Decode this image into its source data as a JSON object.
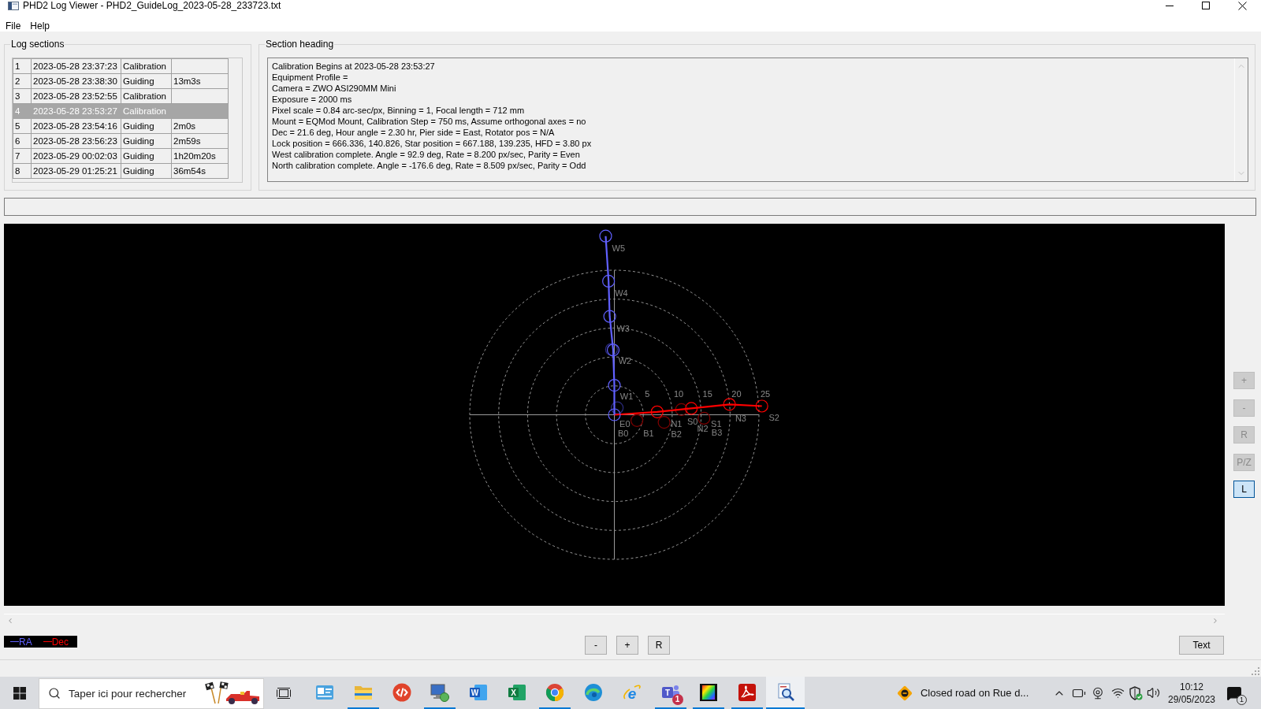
{
  "window": {
    "title": "PHD2 Log Viewer - PHD2_GuideLog_2023-05-28_233723.txt"
  },
  "menu": [
    "File",
    "Help"
  ],
  "log_sections": {
    "title": "Log sections",
    "rows": [
      {
        "cells": [
          "1",
          "2023-05-28 23:37:23",
          "Calibration"
        ],
        "selected": false
      },
      {
        "cells": [
          "2",
          "2023-05-28 23:38:30",
          "Guiding",
          "13m3s"
        ],
        "selected": false
      },
      {
        "cells": [
          "3",
          "2023-05-28 23:52:55",
          "Calibration"
        ],
        "selected": false
      },
      {
        "cells": [
          "4",
          "2023-05-28 23:53:27",
          "Calibration"
        ],
        "selected": true
      },
      {
        "cells": [
          "5",
          "2023-05-28 23:54:16",
          "Guiding",
          "2m0s"
        ],
        "selected": false
      },
      {
        "cells": [
          "6",
          "2023-05-28 23:56:23",
          "Guiding",
          "2m59s"
        ],
        "selected": false
      },
      {
        "cells": [
          "7",
          "2023-05-29 00:02:03",
          "Guiding",
          "1h20m20s"
        ],
        "selected": false
      },
      {
        "cells": [
          "8",
          "2023-05-29 01:25:21",
          "Guiding",
          "36m54s"
        ],
        "selected": false
      }
    ]
  },
  "section_heading": {
    "title": "Section heading",
    "lines": [
      "Calibration Begins at 2023-05-28 23:53:27",
      "Equipment Profile =",
      "Camera = ZWO ASI290MM Mini",
      "Exposure = 2000 ms",
      "Pixel scale = 0.84 arc-sec/px, Binning = 1, Focal length = 712 mm",
      "Mount = EQMod Mount, Calibration Step = 750 ms, Assume orthogonal axes = no",
      "Dec = 21.6 deg, Hour angle = 2.30 hr, Pier side = East, Rotator pos = N/A",
      "Lock position = 666.336, 140.826, Star position = 667.188, 139.235, HFD = 3.80 px",
      "West calibration complete. Angle = 92.9 deg, Rate = 8.200 px/sec, Parity = Even",
      "North calibration complete. Angle = -176.6 deg, Rate = 8.509 px/sec, Parity = Odd"
    ]
  },
  "plot": {
    "ring_labels": [
      "5",
      "10",
      "15",
      "20",
      "25"
    ],
    "point_labels": [
      "W5",
      "W4",
      "W3",
      "W2",
      "W1",
      "E0",
      "N1",
      "S0",
      "S1",
      "N3",
      "S2",
      "N2",
      "B0",
      "B1",
      "B2",
      "B3"
    ],
    "legend": [
      {
        "label": "RA",
        "color": "#6060ff"
      },
      {
        "label": "Dec",
        "color": "#ff0000"
      }
    ],
    "side_buttons": [
      {
        "label": "+",
        "disabled": true,
        "selected": false
      },
      {
        "label": "-",
        "disabled": true,
        "selected": false
      },
      {
        "label": "R",
        "disabled": true,
        "selected": false
      },
      {
        "label": "P/Z",
        "disabled": true,
        "selected": false
      },
      {
        "label": "L",
        "disabled": false,
        "selected": true
      }
    ]
  },
  "view_buttons": [
    "-",
    "+",
    "R"
  ],
  "text_button": "Text",
  "taskbar": {
    "search": {
      "placeholder": "Taper ici pour rechercher"
    },
    "apps": [
      {
        "kind": "widget",
        "running": false,
        "selected": false
      },
      {
        "kind": "folder",
        "running": true,
        "selected": false
      },
      {
        "kind": "remote",
        "running": false,
        "selected": false
      },
      {
        "kind": "network",
        "running": true,
        "selected": false
      },
      {
        "kind": "word",
        "glyph": "W",
        "running": false,
        "selected": false
      },
      {
        "kind": "sheet",
        "glyph": "X",
        "running": false,
        "selected": false
      },
      {
        "kind": "chrome",
        "running": true,
        "selected": false
      },
      {
        "kind": "edge",
        "running": false,
        "selected": false
      },
      {
        "kind": "explorer",
        "glyph": "e",
        "running": false,
        "selected": false
      },
      {
        "kind": "teams",
        "glyph": "T",
        "badge": "1",
        "running": true,
        "selected": false
      },
      {
        "kind": "spectrum",
        "running": true,
        "selected": false
      },
      {
        "kind": "pdf",
        "running": true,
        "selected": false
      },
      {
        "kind": "viewer",
        "running": true,
        "selected": true
      }
    ],
    "notification": {
      "text": "Closed road on Rue d..."
    },
    "clock": {
      "time": "10:12",
      "date": "29/05/2023"
    },
    "action_center": {
      "badge": "1"
    }
  }
}
